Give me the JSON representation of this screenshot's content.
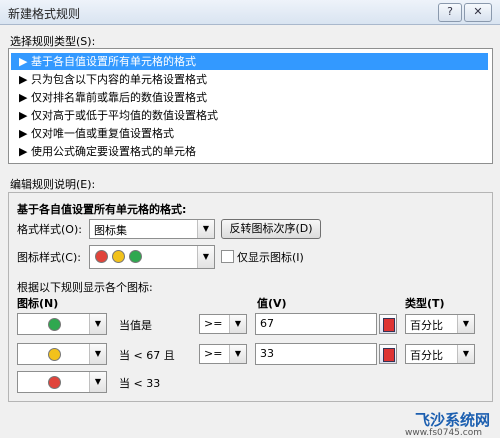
{
  "window": {
    "title": "新建格式规则",
    "help_label": "?",
    "close_label": "✕"
  },
  "rule_type": {
    "label": "选择规则类型(S):",
    "items": [
      "▶ 基于各自值设置所有单元格的格式",
      "▶ 只为包含以下内容的单元格设置格式",
      "▶ 仅对排名靠前或靠后的数值设置格式",
      "▶ 仅对高于或低于平均值的数值设置格式",
      "▶ 仅对唯一值或重复值设置格式",
      "▶ 使用公式确定要设置格式的单元格"
    ],
    "selected_index": 0
  },
  "edit": {
    "label": "编辑规则说明(E):",
    "heading": "基于各自值设置所有单元格的格式:",
    "format_style_label": "格式样式(O):",
    "format_style_value": "图标集",
    "reverse_button": "反转图标次序(D)",
    "icon_style_label": "图标样式(C):",
    "show_icon_only_label": "仅显示图标(I)",
    "show_icon_only_checked": false,
    "rules_caption": "根据以下规则显示各个图标:",
    "col_icon": "图标(N)",
    "col_value": "值(V)",
    "col_type": "类型(T)",
    "rows": [
      {
        "icon_color": "#2fa84f",
        "condition": "当值是",
        "operator": ">=",
        "value": "67",
        "type": "百分比"
      },
      {
        "icon_color": "#f2c21b",
        "condition": "当 < 67 且",
        "operator": ">=",
        "value": "33",
        "type": "百分比"
      },
      {
        "icon_color": "#e0443b",
        "condition": "当 < 33"
      }
    ]
  },
  "icon_set_colors": [
    "#e0443b",
    "#f2c21b",
    "#2fa84f"
  ],
  "watermark": {
    "brand": "飞沙系统网",
    "url": "www.fs0745.com"
  }
}
